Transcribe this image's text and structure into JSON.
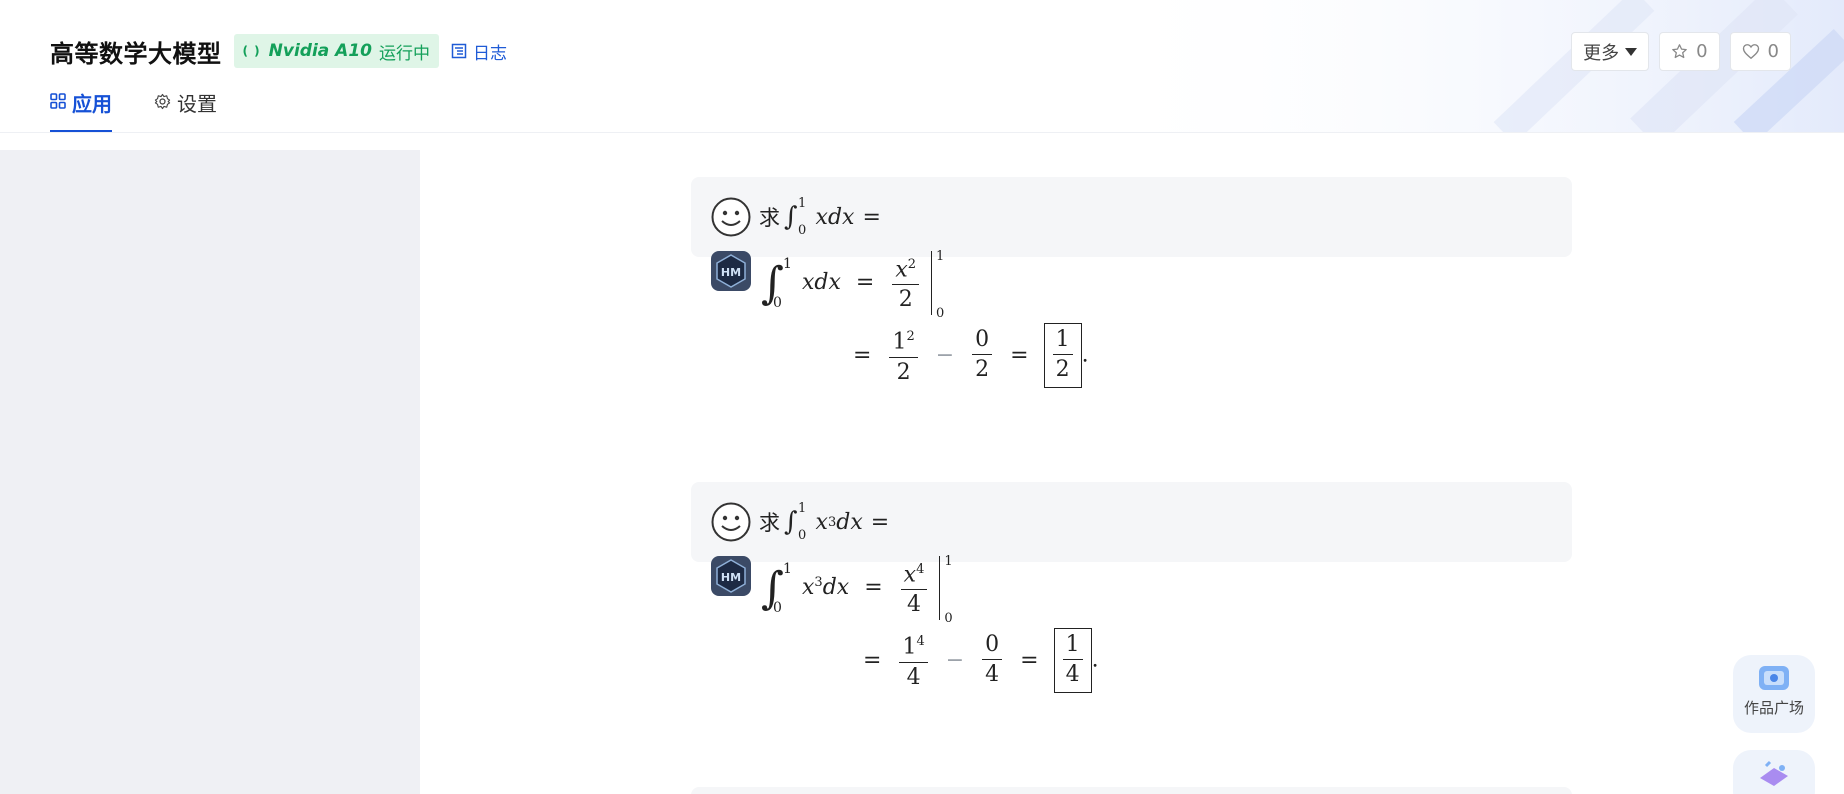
{
  "header": {
    "title": "高等数学大模型",
    "status": {
      "gpu_icon": "( )",
      "gpu_name": "Nvidia A10",
      "state": "运行中",
      "color": "#14a05a"
    },
    "log_label": "日志",
    "tabs": [
      {
        "label": "应用",
        "icon": "apps-icon",
        "active": true
      },
      {
        "label": "设置",
        "icon": "gear-icon",
        "active": false
      }
    ],
    "actions": {
      "more_label": "更多",
      "star_count": "0",
      "like_count": "0"
    }
  },
  "conversation": [
    {
      "role": "user",
      "prefix": "求",
      "lower": "0",
      "upper": "1",
      "integrand": "xdx",
      "power": "",
      "equals": "="
    },
    {
      "role": "bot",
      "lower": "0",
      "upper": "1",
      "integrand_power": "",
      "antideriv_num_power": "2",
      "antideriv_den": "2",
      "step_num_base": "1",
      "step_num_power": "2",
      "step_den": "2",
      "zero_num": "0",
      "zero_den": "2",
      "result_num": "1",
      "result_den": "2",
      "period": "."
    },
    {
      "role": "user",
      "prefix": "求",
      "lower": "0",
      "upper": "1",
      "integrand": "dx",
      "power": "3",
      "equals": "="
    },
    {
      "role": "bot",
      "lower": "0",
      "upper": "1",
      "integrand_power": "3",
      "antideriv_num_power": "4",
      "antideriv_den": "4",
      "step_num_base": "1",
      "step_num_power": "4",
      "step_den": "4",
      "zero_num": "0",
      "zero_den": "4",
      "result_num": "1",
      "result_den": "4",
      "period": "."
    }
  ],
  "floating": {
    "gallery_label": "作品广场",
    "second_icon": "create-icon"
  },
  "colors": {
    "accent": "#1651d6",
    "status_bg": "#dff5e7",
    "left_panel": "#eff0f4",
    "card_bg": "#f5f6f8"
  }
}
